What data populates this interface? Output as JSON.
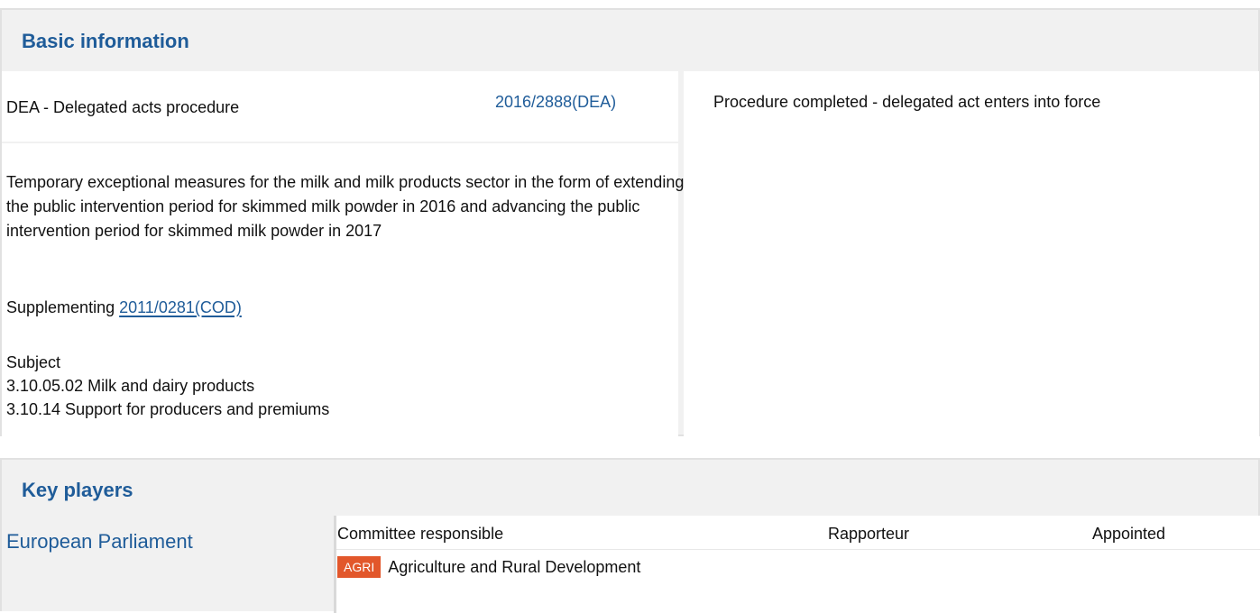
{
  "basic_info": {
    "title": "Basic information",
    "procedure_type": "DEA - Delegated acts procedure",
    "procedure_ref": "2016/2888(DEA)",
    "status": "Procedure completed - delegated act enters into force",
    "description": "Temporary exceptional measures for the milk and milk products sector in the form of extending the public intervention period for skimmed milk powder in 2016 and advancing the public intervention period for skimmed milk powder in 2017",
    "supplementing_label": "Supplementing",
    "supplementing_ref": "2011/0281(COD)",
    "subject_label": "Subject",
    "subjects": [
      "3.10.05.02 Milk and dairy products",
      "3.10.14 Support for producers and premiums"
    ]
  },
  "key_players": {
    "title": "Key players",
    "institution": "European Parliament",
    "columns": {
      "committee": "Committee responsible",
      "rapporteur": "Rapporteur",
      "appointed": "Appointed"
    },
    "committee": {
      "code": "AGRI",
      "name": "Agriculture and Rural Development"
    }
  },
  "colors": {
    "link": "#1f5c99",
    "badge": "#e2572b",
    "panel_bg": "#f1f1f1"
  }
}
